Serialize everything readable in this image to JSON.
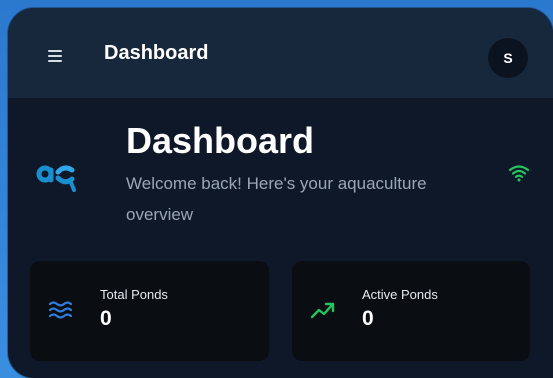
{
  "appbar": {
    "title": "Dashboard",
    "avatar_initial": "S",
    "menu_icon": "hamburger-menu-icon"
  },
  "hero": {
    "title": "Dashboard",
    "subtitle": "Welcome back! Here's your aquaculture overview",
    "logo_icon": "aq-logo",
    "status_icon": "wifi-icon"
  },
  "cards": [
    {
      "label": "Total Ponds",
      "value": "0",
      "icon": "waves-icon"
    },
    {
      "label": "Active Ponds",
      "value": "0",
      "icon": "trending-up-icon"
    }
  ],
  "colors": {
    "background": "#2b78cf",
    "panel": "#0e1828",
    "appbar": "#17273c",
    "card": "#0a0d12",
    "accent_blue": "#2f7fe0",
    "accent_green": "#22c55e",
    "logo_blue": "#1a8fd0"
  }
}
